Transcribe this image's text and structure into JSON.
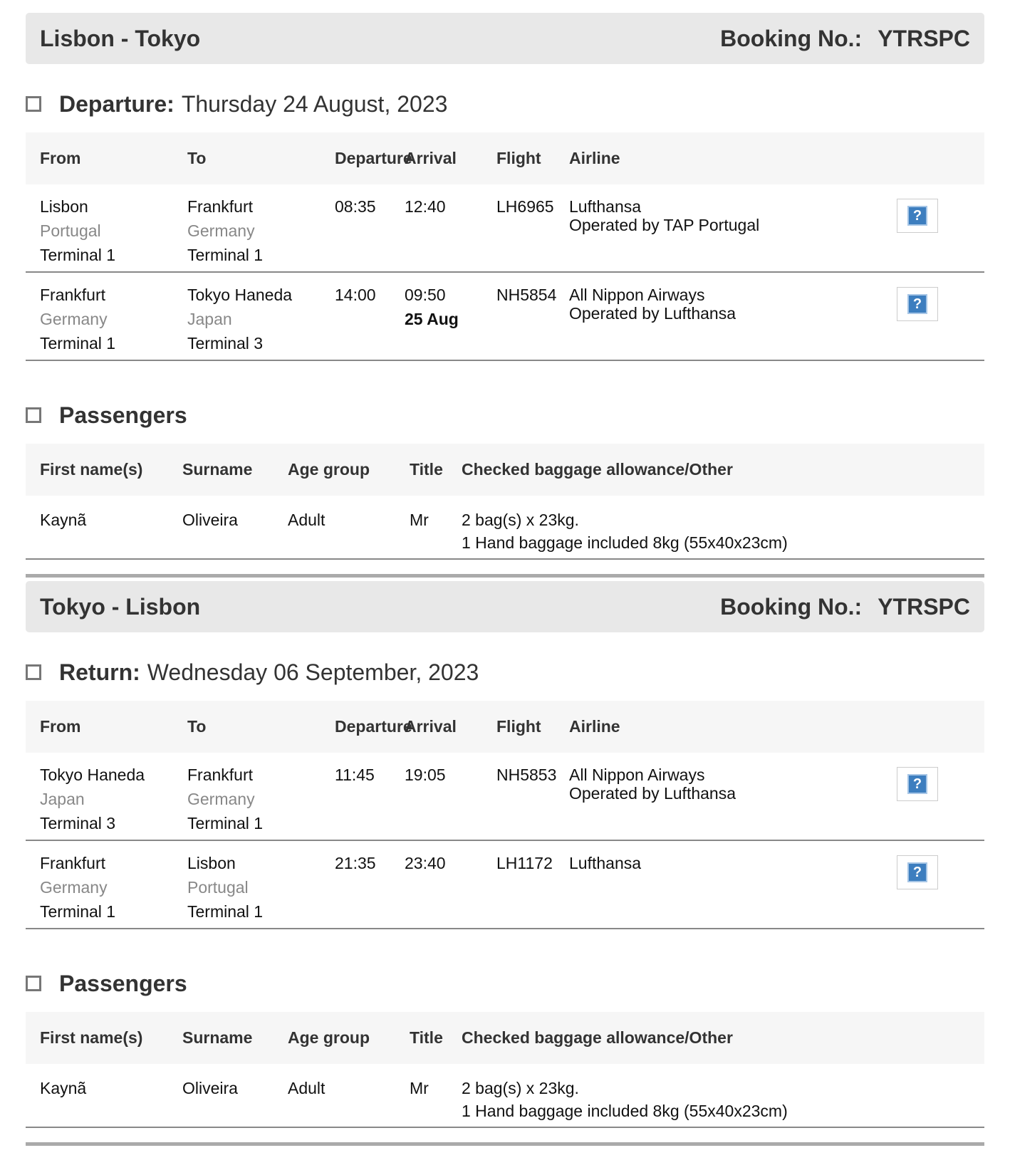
{
  "outbound": {
    "route": "Lisbon - Tokyo",
    "booking_label": "Booking No.:",
    "booking_no": "YTRSPC",
    "section_label": "Departure:",
    "section_date": "Thursday 24 August, 2023",
    "headers": {
      "from": "From",
      "to": "To",
      "departure": "Departure",
      "arrival": "Arrival",
      "flight": "Flight",
      "airline": "Airline"
    },
    "flights": [
      {
        "from_city": "Lisbon",
        "from_country": "Portugal",
        "from_terminal": "Terminal 1",
        "to_city": "Frankfurt",
        "to_country": "Germany",
        "to_terminal": "Terminal 1",
        "dep": "08:35",
        "arr": "12:40",
        "arr_date": "",
        "flight": "LH6965",
        "airline": "Lufthansa",
        "operated": "Operated by TAP Portugal",
        "help": "?"
      },
      {
        "from_city": "Frankfurt",
        "from_country": "Germany",
        "from_terminal": "Terminal 1",
        "to_city": "Tokyo Haneda",
        "to_country": "Japan",
        "to_terminal": "Terminal 3",
        "dep": "14:00",
        "arr": "09:50",
        "arr_date": "25 Aug",
        "flight": "NH5854",
        "airline": "All Nippon Airways",
        "operated": "Operated by Lufthansa",
        "help": "?"
      }
    ],
    "passengers_title": "Passengers",
    "pax_headers": {
      "first": "First name(s)",
      "surname": "Surname",
      "age": "Age group",
      "title": "Title",
      "baggage": "Checked baggage allowance/Other"
    },
    "passengers": [
      {
        "first": "Kaynã",
        "surname": "Oliveira",
        "age": "Adult",
        "title": "Mr",
        "bag1": "2 bag(s) x 23kg.",
        "bag2": "1 Hand baggage included 8kg (55x40x23cm)"
      }
    ]
  },
  "return": {
    "route": "Tokyo - Lisbon",
    "booking_label": "Booking No.:",
    "booking_no": "YTRSPC",
    "section_label": "Return:",
    "section_date": "Wednesday 06 September, 2023",
    "headers": {
      "from": "From",
      "to": "To",
      "departure": "Departure",
      "arrival": "Arrival",
      "flight": "Flight",
      "airline": "Airline"
    },
    "flights": [
      {
        "from_city": "Tokyo Haneda",
        "from_country": "Japan",
        "from_terminal": "Terminal 3",
        "to_city": "Frankfurt",
        "to_country": "Germany",
        "to_terminal": "Terminal 1",
        "dep": "11:45",
        "arr": "19:05",
        "arr_date": "",
        "flight": "NH5853",
        "airline": "All Nippon Airways",
        "operated": "Operated by Lufthansa",
        "help": "?"
      },
      {
        "from_city": "Frankfurt",
        "from_country": "Germany",
        "from_terminal": "Terminal 1",
        "to_city": "Lisbon",
        "to_country": "Portugal",
        "to_terminal": "Terminal 1",
        "dep": "21:35",
        "arr": "23:40",
        "arr_date": "",
        "flight": "LH1172",
        "airline": "Lufthansa",
        "operated": "",
        "help": "?"
      }
    ],
    "passengers_title": "Passengers",
    "pax_headers": {
      "first": "First name(s)",
      "surname": "Surname",
      "age": "Age group",
      "title": "Title",
      "baggage": "Checked baggage allowance/Other"
    },
    "passengers": [
      {
        "first": "Kaynã",
        "surname": "Oliveira",
        "age": "Adult",
        "title": "Mr",
        "bag1": "2 bag(s) x 23kg.",
        "bag2": "1 Hand baggage included 8kg (55x40x23cm)"
      }
    ]
  }
}
